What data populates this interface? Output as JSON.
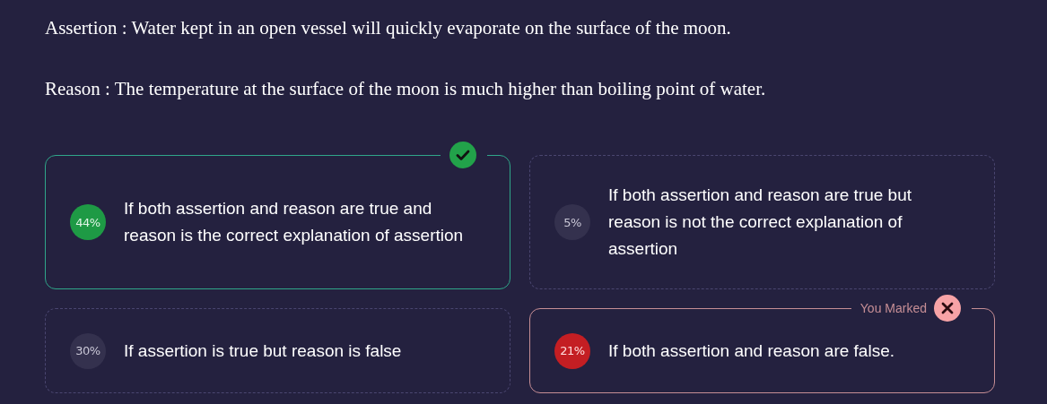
{
  "question": {
    "assertion": "Assertion : Water kept in an open vessel will quickly evaporate on the surface of the moon.",
    "reason": "Reason : The temperature at the surface of the moon is much higher than boiling point of water."
  },
  "options": [
    {
      "kind": "correct",
      "percent": "44%",
      "text": "If both assertion and reason are true and reason is the correct explanation of assertion"
    },
    {
      "kind": "plain",
      "percent": "5%",
      "text": "If both assertion and reason are true but reason is not the correct explanation of assertion"
    },
    {
      "kind": "plain",
      "percent": "30%",
      "text": "If assertion is true but reason is false"
    },
    {
      "kind": "wrong",
      "percent": "21%",
      "text": "If both assertion and reason are false.",
      "tag": "You Marked"
    }
  ]
}
